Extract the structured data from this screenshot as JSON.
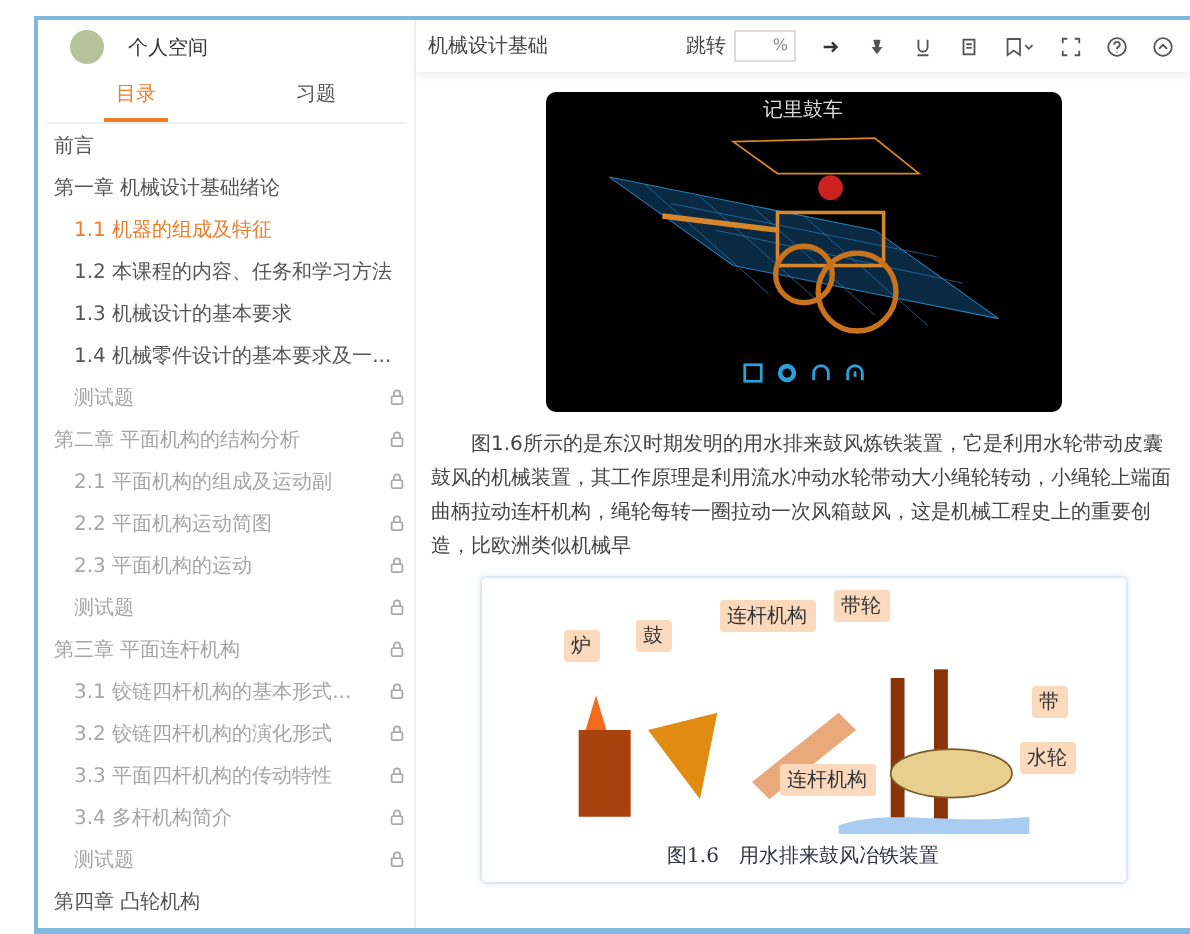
{
  "sidebar": {
    "user": "个人空间",
    "tabs": [
      {
        "label": "目录",
        "selected": true
      },
      {
        "label": "习题",
        "selected": false
      }
    ],
    "outline": [
      {
        "label": "前言",
        "selected": false,
        "locked": false
      },
      {
        "label": "第一章 机械设计基础绪论",
        "selected": false,
        "locked": false,
        "children": [
          {
            "label": "1.1 机器的组成及特征",
            "selected": true,
            "locked": false
          },
          {
            "label": "1.2 本课程的内容、任务和学习方法",
            "selected": false,
            "locked": false
          },
          {
            "label": "1.3 机械设计的基本要求",
            "selected": false,
            "locked": false
          },
          {
            "label": "1.4 机械零件设计的基本要求及一...",
            "selected": false,
            "locked": false
          },
          {
            "label": "测试题",
            "selected": false,
            "locked": true
          }
        ]
      },
      {
        "label": "第二章 平面机构的结构分析",
        "selected": false,
        "locked": true,
        "children": [
          {
            "label": "2.1 平面机构的组成及运动副",
            "selected": false,
            "locked": true
          },
          {
            "label": "2.2 平面机构运动简图",
            "selected": false,
            "locked": true
          },
          {
            "label": "2.3 平面机构的运动",
            "selected": false,
            "locked": true
          },
          {
            "label": "测试题",
            "selected": false,
            "locked": true
          }
        ]
      },
      {
        "label": "第三章 平面连杆机构",
        "selected": false,
        "locked": true,
        "children": [
          {
            "label": "3.1 铰链四杆机构的基本形式...",
            "selected": false,
            "locked": true
          },
          {
            "label": "3.2 铰链四杆机构的演化形式",
            "selected": false,
            "locked": true
          },
          {
            "label": "3.3 平面四杆机构的传动特性",
            "selected": false,
            "locked": true
          },
          {
            "label": "3.4 多杆机构简介",
            "selected": false,
            "locked": true
          },
          {
            "label": "测试题",
            "selected": false,
            "locked": true
          }
        ]
      },
      {
        "label": "第四章 凸轮机构",
        "selected": false,
        "locked": false
      }
    ]
  },
  "toolbar": {
    "title": "机械设计基础",
    "jump_label": "跳转",
    "jump_unit": "%"
  },
  "viewer": {
    "title": "记里鼓车"
  },
  "paragraph": "图1.6所示的是东汉时期发明的用水排来鼓风炼铁装置，它是利用水轮带动皮囊鼓风的机械装置，其工作原理是利用流水冲动水轮带动大小绳轮转动，小绳轮上端面曲柄拉动连杆机构，绳轮每转一圈拉动一次风箱鼓风，这是机械工程史上的重要创造，比欧洲类似机械早",
  "figure": {
    "labels": [
      "炉",
      "鼓",
      "连杆机构",
      "带轮",
      "带",
      "水轮",
      "连杆机构"
    ],
    "caption": "图1.6　用水排来鼓风冶铁装置"
  }
}
